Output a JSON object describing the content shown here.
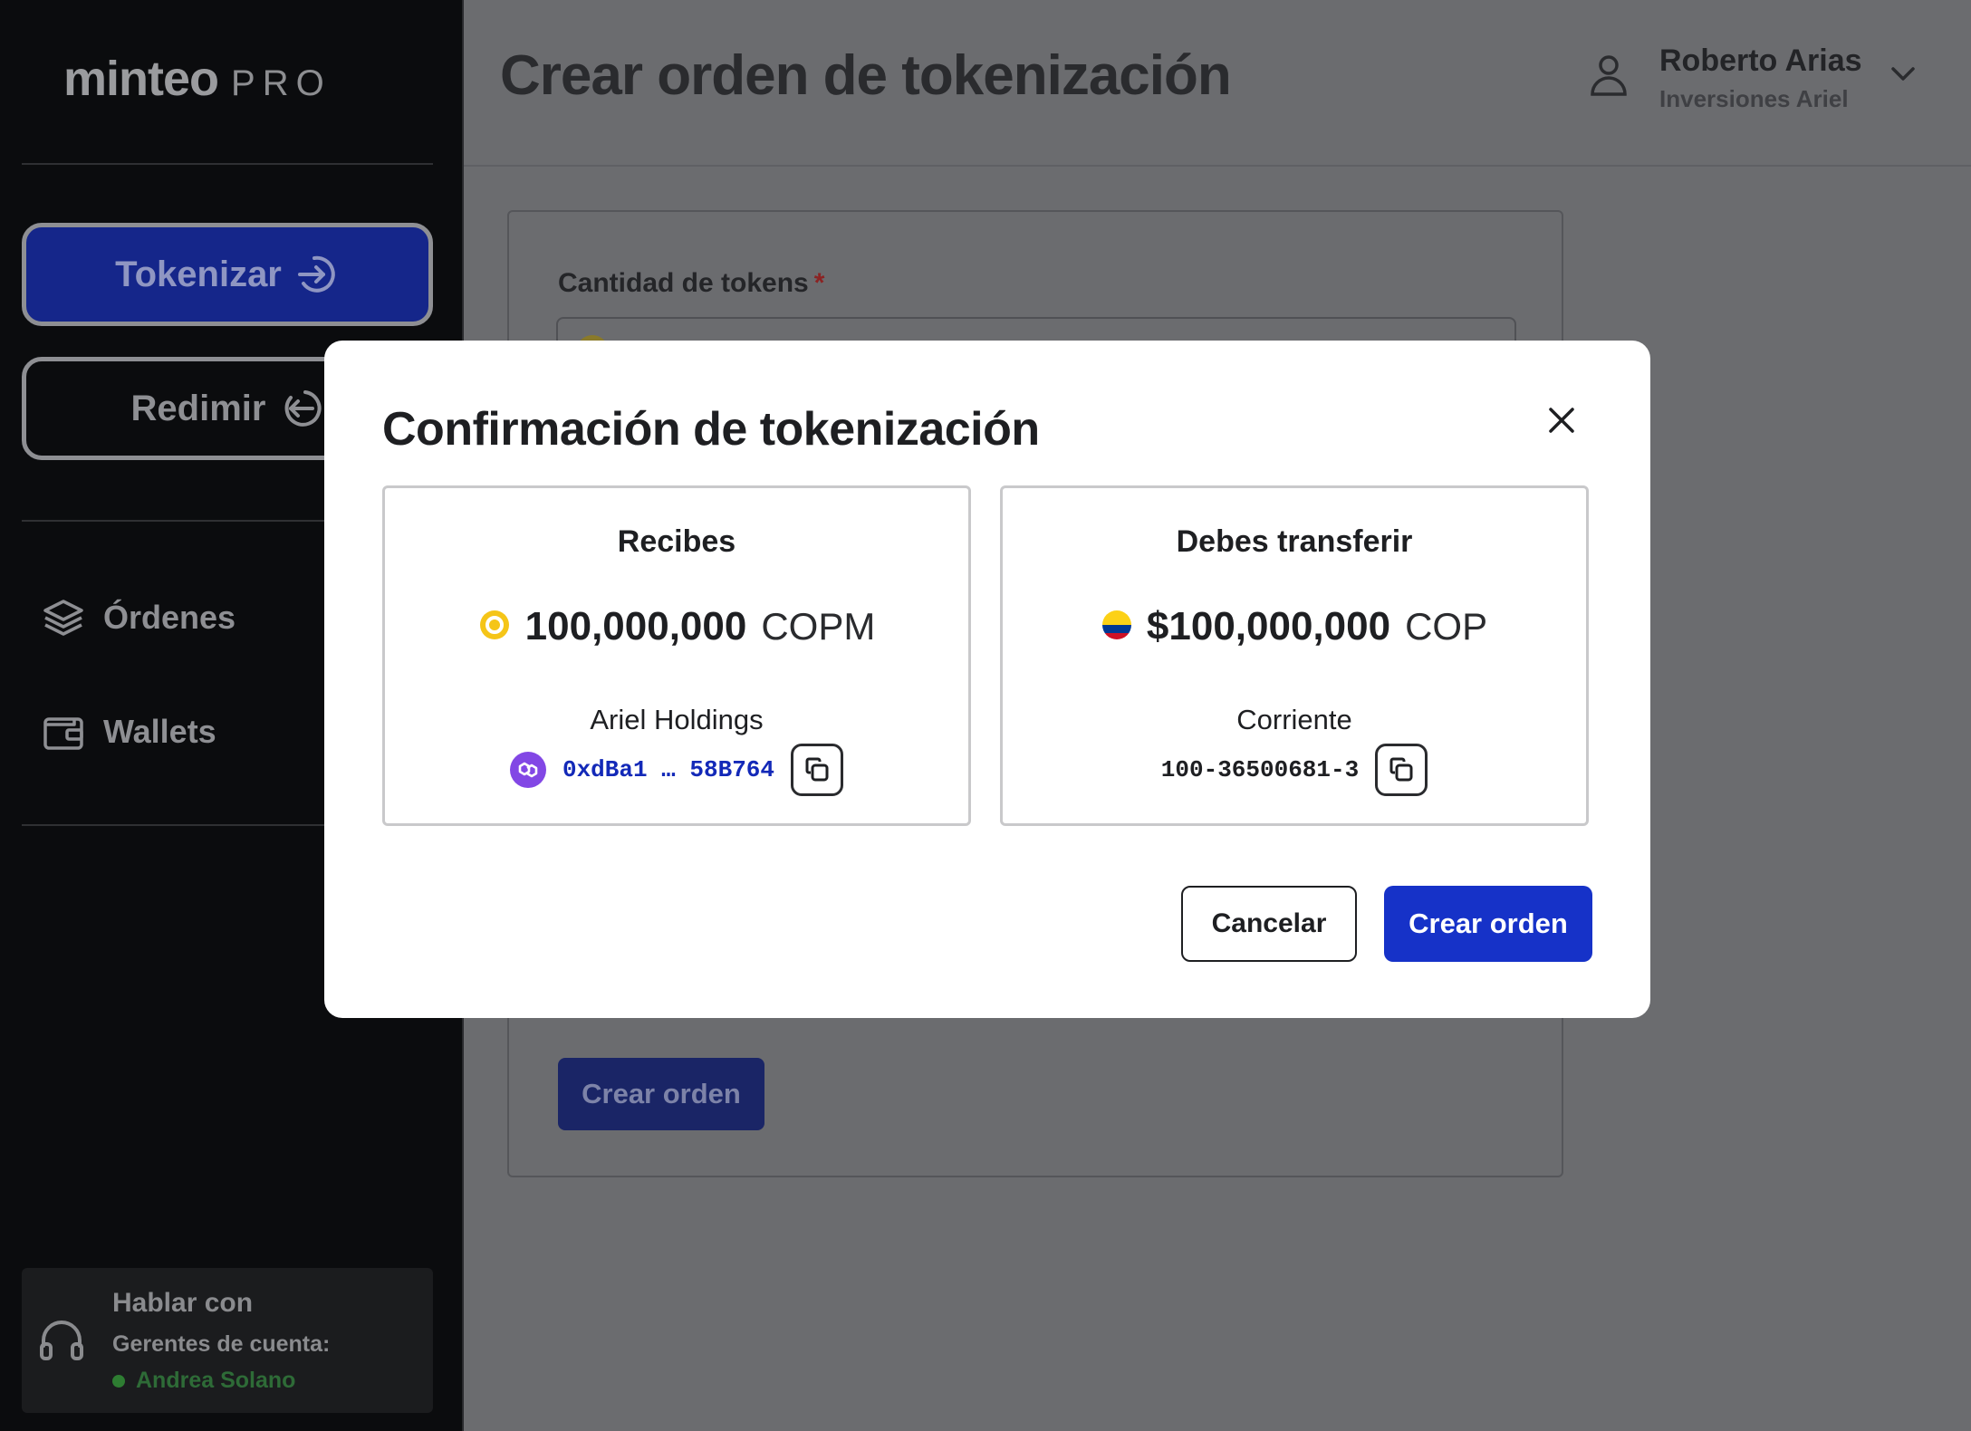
{
  "brand": {
    "name": "minteo",
    "suffix": "PRO"
  },
  "sidebar": {
    "primary_actions": [
      {
        "label": "Tokenizar",
        "icon": "arrow-in-circle-icon"
      },
      {
        "label": "Redimir",
        "icon": "arrow-out-circle-icon"
      }
    ],
    "nav": [
      {
        "label": "Órdenes",
        "icon": "layers-icon"
      },
      {
        "label": "Wallets",
        "icon": "wallet-icon"
      }
    ],
    "support": {
      "title": "Hablar con",
      "subtitle": "Gerentes de cuenta:",
      "agent": "Andrea Solano",
      "agent_status_color": "#2e7d32"
    }
  },
  "header": {
    "title": "Crear orden de tokenización",
    "user": {
      "name": "Roberto Arias",
      "organization": "Inversiones Ariel"
    }
  },
  "form": {
    "quantity_label": "Cantidad de tokens",
    "required_marker": "*",
    "submit_label": "Crear orden"
  },
  "modal": {
    "title": "Confirmación de tokenización",
    "receive": {
      "heading": "Recibes",
      "amount": "100,000,000",
      "unit": "COPM",
      "wallet_name": "Ariel Holdings",
      "address": "0xdBa1 … 58B764",
      "token_icon": "copm-token-icon",
      "network_icon": "polygon-icon"
    },
    "transfer": {
      "heading": "Debes transferir",
      "amount": "$100,000,000",
      "unit": "COP",
      "account_type": "Corriente",
      "account_number": "100-36500681-3",
      "currency_icon": "colombia-flag-icon"
    },
    "cancel_label": "Cancelar",
    "confirm_label": "Crear orden"
  },
  "colors": {
    "primary": "#1632c8",
    "address_text": "#1329b8",
    "token_yellow": "#f5c518",
    "polygon_purple": "#8247e5"
  }
}
